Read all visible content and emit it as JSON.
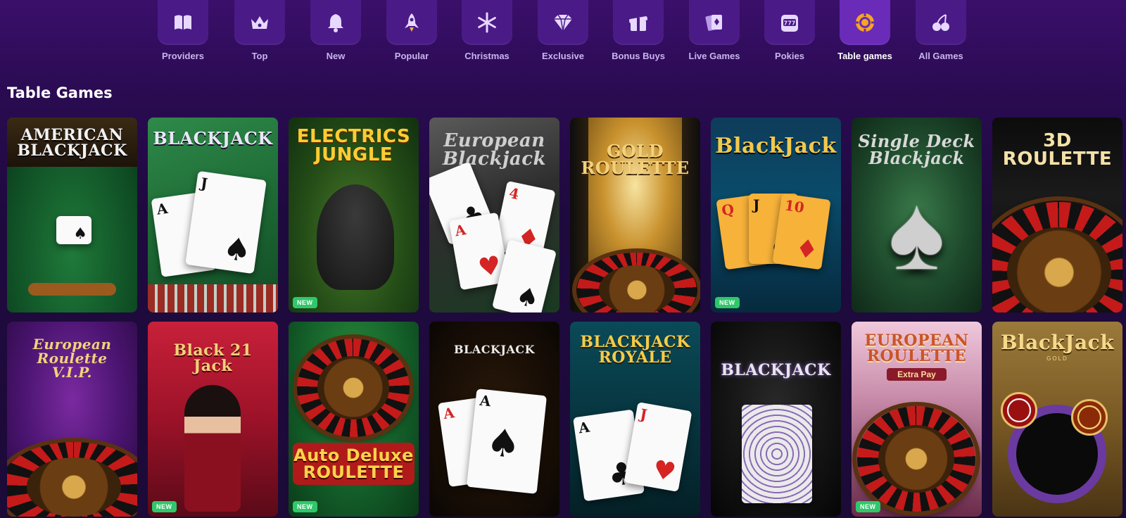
{
  "categories": [
    {
      "label": "Providers",
      "icon": "book-icon",
      "active": false
    },
    {
      "label": "Top",
      "icon": "crown-icon",
      "active": false
    },
    {
      "label": "New",
      "icon": "bell-icon",
      "active": false
    },
    {
      "label": "Popular",
      "icon": "rocket-icon",
      "active": false
    },
    {
      "label": "Christmas",
      "icon": "snowflake-icon",
      "active": false
    },
    {
      "label": "Exclusive",
      "icon": "diamond-icon",
      "active": false
    },
    {
      "label": "Bonus Buys",
      "icon": "gift-icon",
      "active": false
    },
    {
      "label": "Live Games",
      "icon": "cards-icon",
      "active": false
    },
    {
      "label": "Pokies",
      "icon": "slot-machine-icon",
      "active": false
    },
    {
      "label": "Table games",
      "icon": "poker-chip-icon",
      "active": true
    },
    {
      "label": "All Games",
      "icon": "cherries-icon",
      "active": false
    }
  ],
  "section_title": "Table Games",
  "badge_new": "NEW",
  "games": [
    {
      "title": "AMERICAN\nBLACKJACK",
      "new": false
    },
    {
      "title": "BLACKJACK",
      "new": false
    },
    {
      "title": "ELECTRICS\nJUNGLE",
      "new": true
    },
    {
      "title": "European\nBlackjack",
      "new": false
    },
    {
      "title": "GOLD\nROULETTE",
      "new": false
    },
    {
      "title": "BlackJack",
      "new": true
    },
    {
      "title": "Single Deck\nBlackjack",
      "new": false
    },
    {
      "title": "3D\nROULETTE",
      "new": false
    },
    {
      "title": "European Roulette\nV.I.P.",
      "new": false
    },
    {
      "title": "Black 21 Jack",
      "new": true
    },
    {
      "title": "Auto Deluxe\nROULETTE",
      "new": true
    },
    {
      "title": "BLACKJACK",
      "new": false
    },
    {
      "title": "BLACKJACK\nROYALE",
      "new": false
    },
    {
      "title": "BLACKJACK",
      "new": false
    },
    {
      "title": "EUROPEAN\nROULETTE",
      "subtitle": "Extra Pay",
      "new": true
    },
    {
      "title": "BlackJack",
      "subtitle": "GOLD",
      "new": false
    }
  ]
}
